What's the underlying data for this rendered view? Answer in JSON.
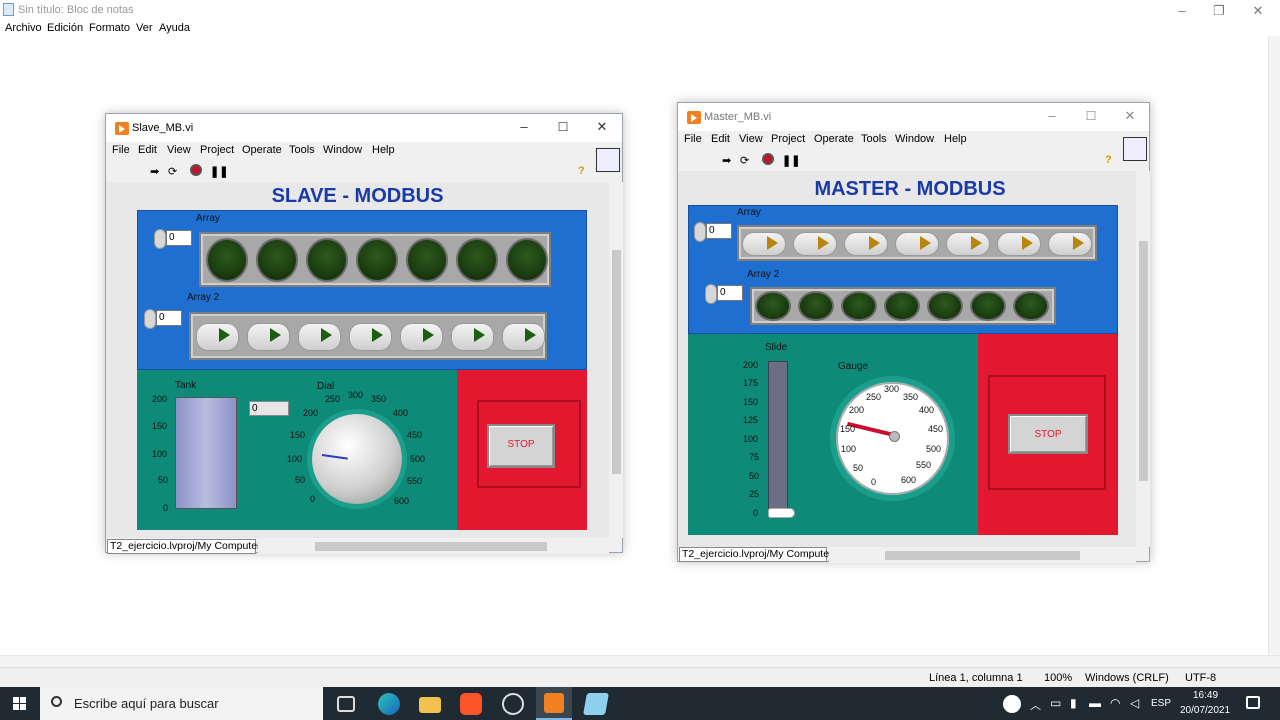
{
  "notepad": {
    "title": "Sin título: Bloc de notas",
    "menu": [
      "Archivo",
      "Edición",
      "Formato",
      "Ver",
      "Ayuda"
    ],
    "window_controls": [
      "–",
      "❐",
      "✕"
    ],
    "status": {
      "position": "Línea 1, columna 1",
      "zoom": "100%",
      "line_ending": "Windows (CRLF)",
      "encoding": "UTF-8"
    }
  },
  "slave": {
    "title": "Slave_MB.vi",
    "menu": [
      "File",
      "Edit",
      "View",
      "Project",
      "Operate",
      "Tools",
      "Window",
      "Help"
    ],
    "panel_title": "SLAVE - MODBUS",
    "array_label": "Array",
    "array_index": "0",
    "array_leds": 7,
    "array2_label": "Array 2",
    "array2_index": "0",
    "array2_buttons": 7,
    "tank_label": "Tank",
    "tank_ticks": [
      "200",
      "150",
      "100",
      "50",
      "0"
    ],
    "tank_value_display": "0",
    "dial_label": "Dial",
    "dial_ticks": [
      "0",
      "50",
      "100",
      "150",
      "200",
      "250",
      "300",
      "350",
      "400",
      "450",
      "500",
      "550",
      "600"
    ],
    "stop_label": "STOP",
    "path": "T2_ejercicio.lvproj/My Computer"
  },
  "master": {
    "title": "Master_MB.vi",
    "menu": [
      "File",
      "Edit",
      "View",
      "Project",
      "Operate",
      "Tools",
      "Window",
      "Help"
    ],
    "panel_title": "MASTER - MODBUS",
    "array_label": "Array",
    "array_index": "0",
    "array_buttons": 7,
    "array2_label": "Array 2",
    "array2_index": "0",
    "array2_leds": 7,
    "slide_label": "Slide",
    "slide_ticks": [
      "200",
      "175",
      "150",
      "125",
      "100",
      "75",
      "50",
      "25",
      "0"
    ],
    "gauge_label": "Gauge",
    "gauge_ticks": [
      "0",
      "50",
      "100",
      "150",
      "200",
      "250",
      "300",
      "350",
      "400",
      "450",
      "500",
      "550",
      "600"
    ],
    "gauge_value": 130,
    "stop_label": "STOP",
    "path": "T2_ejercicio.lvproj/My Computer"
  },
  "taskbar": {
    "search_placeholder": "Escribe aquí para buscar",
    "lang": "ESP",
    "time": "16:49",
    "date": "20/07/2021"
  },
  "colors": {
    "title_blue": "#1a3aa8",
    "panel_blue": "#1f6fd1",
    "panel_teal": "#0e8a78",
    "panel_red": "#e3172f",
    "led_green": "#1b3d10",
    "needle_red": "#c8102e"
  }
}
